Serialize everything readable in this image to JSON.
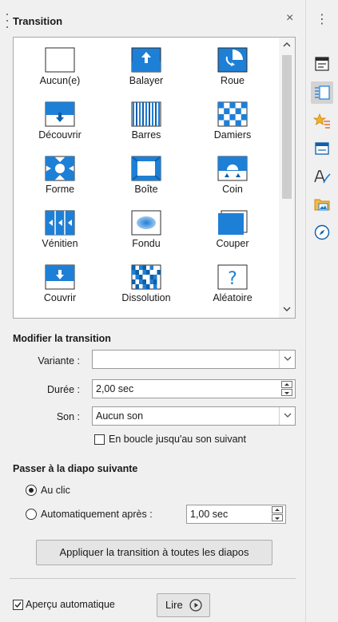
{
  "panel": {
    "title": "Transition",
    "close_glyph": "×"
  },
  "gallery": {
    "items": [
      {
        "label": "Aucun(e)",
        "icon": "transition-none-icon"
      },
      {
        "label": "Balayer",
        "icon": "transition-wipe-icon"
      },
      {
        "label": "Roue",
        "icon": "transition-wheel-icon"
      },
      {
        "label": "Découvrir",
        "icon": "transition-uncover-icon"
      },
      {
        "label": "Barres",
        "icon": "transition-bars-icon"
      },
      {
        "label": "Damiers",
        "icon": "transition-checkers-icon"
      },
      {
        "label": "Forme",
        "icon": "transition-shape-icon"
      },
      {
        "label": "Boîte",
        "icon": "transition-box-icon"
      },
      {
        "label": "Coin",
        "icon": "transition-wedge-icon"
      },
      {
        "label": "Vénitien",
        "icon": "transition-venetian-icon"
      },
      {
        "label": "Fondu",
        "icon": "transition-fade-icon"
      },
      {
        "label": "Couper",
        "icon": "transition-cut-icon"
      },
      {
        "label": "Couvrir",
        "icon": "transition-cover-icon"
      },
      {
        "label": "Dissolution",
        "icon": "transition-dissolve-icon"
      },
      {
        "label": "Aléatoire",
        "icon": "transition-random-icon"
      }
    ]
  },
  "modify": {
    "heading": "Modifier la transition",
    "variant_label": "Variante :",
    "variant_value": "",
    "duration_label": "Durée :",
    "duration_value": "2,00 sec",
    "sound_label": "Son :",
    "sound_value": "Aucun son",
    "loop_label": "En boucle jusqu'au son suivant"
  },
  "advance": {
    "heading": "Passer à la diapo suivante",
    "on_click_label": "Au clic",
    "auto_label": "Automatiquement après :",
    "auto_value": "1,00 sec"
  },
  "apply_all_label": "Appliquer la transition à toutes les diapos",
  "footer": {
    "preview_label": "Aperçu automatique",
    "play_label": "Lire"
  },
  "colors": {
    "accent": "#1e7fd6",
    "accent_dark": "#0f5fa8"
  },
  "sidebar": {
    "more_glyph": "⋮",
    "buttons": [
      "properties-icon",
      "slide-transition-icon",
      "animation-icon",
      "master-slides-icon",
      "styles-icon",
      "gallery-icon",
      "navigator-icon"
    ]
  }
}
